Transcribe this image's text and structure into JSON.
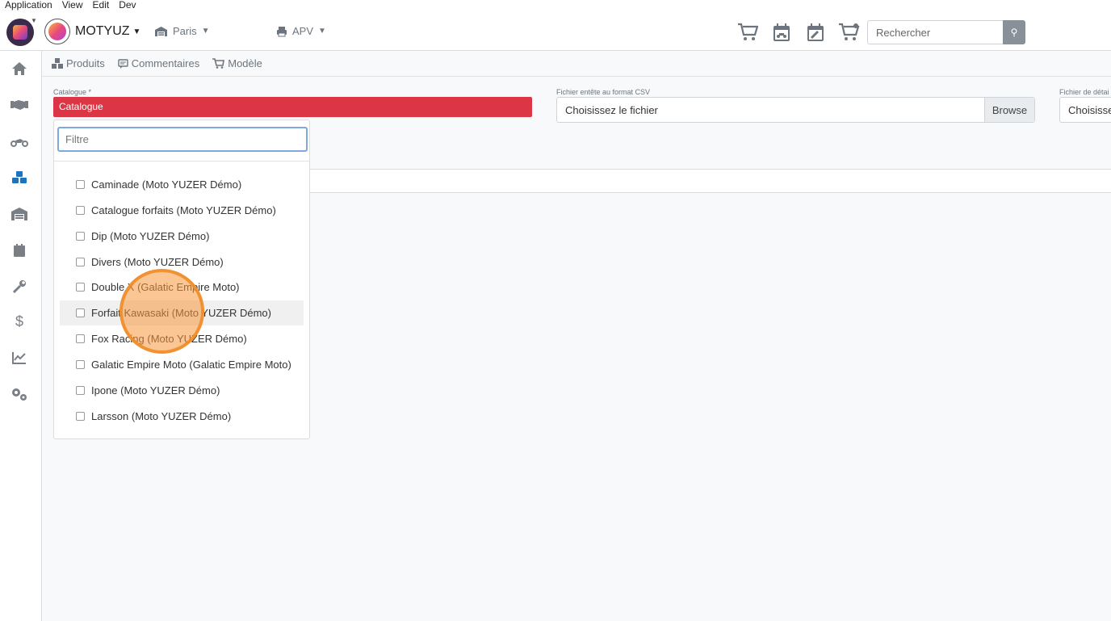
{
  "menubar": {
    "items": [
      "Application",
      "View",
      "Edit",
      "Dev"
    ]
  },
  "header": {
    "brand": "MOTYUZ",
    "location": "Paris",
    "service": "APV",
    "search_placeholder": "Rechercher"
  },
  "tabs": [
    {
      "label": "Produits",
      "icon": "cubes-icon"
    },
    {
      "label": "Commentaires",
      "icon": "comments-icon"
    },
    {
      "label": "Modèle",
      "icon": "cart-icon"
    }
  ],
  "form": {
    "catalogue_label": "Catalogue *",
    "catalogue_value": "Catalogue",
    "csv_header_label": "Fichier entête au format CSV",
    "csv_header_value": "Choisissez le fichier",
    "browse_label": "Browse",
    "detail_label": "Fichier de détai",
    "detail_value": "Choisissez"
  },
  "dropdown": {
    "filter_placeholder": "Filtre",
    "options": [
      "Caminade (Moto YUZER Démo)",
      "Catalogue forfaits (Moto YUZER Démo)",
      "Dip (Moto YUZER Démo)",
      "Divers (Moto YUZER Démo)",
      "Double X (Galatic Empire Moto)",
      "Forfait Kawasaki (Moto YUZER Démo)",
      "Fox Racing (Moto YUZER Démo)",
      "Galatic Empire Moto (Galatic Empire Moto)",
      "Ipone (Moto YUZER Démo)",
      "Larsson (Moto YUZER Démo)"
    ],
    "hovered_index": 5
  },
  "colors": {
    "accent": "#1e73be",
    "danger": "#dc3545",
    "highlight": "#f7963c"
  }
}
